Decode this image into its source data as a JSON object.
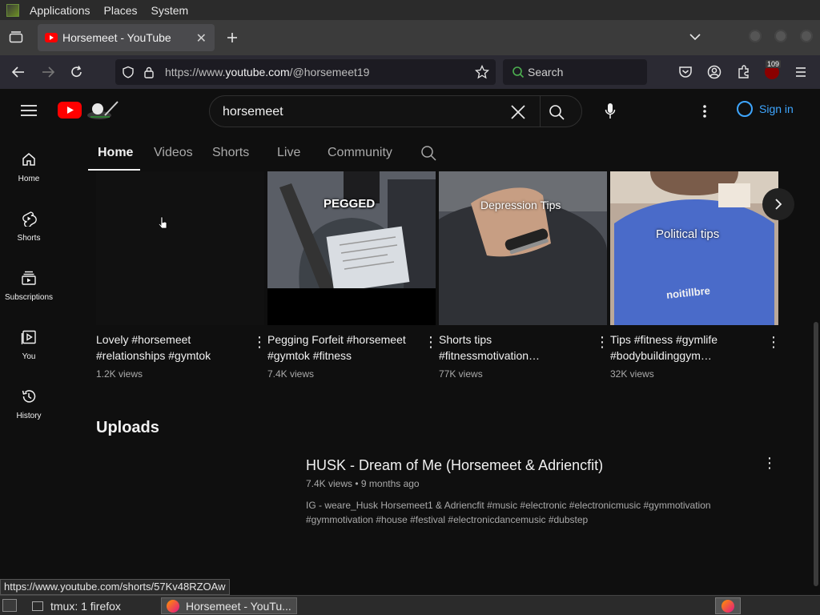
{
  "system_bar": {
    "menus": [
      "Applications",
      "Places",
      "System"
    ]
  },
  "browser": {
    "tab_title": "Horsemeet - YouTube",
    "url_prefix": "https://www.",
    "url_domain": "youtube.com",
    "url_path": "/@horsemeet19",
    "search_placeholder": "Search",
    "extension_badge": "109"
  },
  "youtube": {
    "search_query": "horsemeet",
    "sign_in": "Sign in",
    "sidebar": [
      {
        "label": "Home",
        "icon": "home-icon"
      },
      {
        "label": "Shorts",
        "icon": "shorts-icon"
      },
      {
        "label": "Subscriptions",
        "icon": "subscriptions-icon"
      },
      {
        "label": "You",
        "icon": "you-icon"
      },
      {
        "label": "History",
        "icon": "history-icon"
      }
    ],
    "channel_tabs": [
      "Home",
      "Videos",
      "Shorts",
      "Live",
      "Community"
    ],
    "shorts": [
      {
        "title_line1": "Lovely #horsemeet",
        "title_line2": "#relationships #gymtok",
        "views": "1.2K views",
        "overlay": ""
      },
      {
        "title_line1": "Pegging Forfeit #horsemeet",
        "title_line2": "#gymtok #fitness",
        "views": "7.4K views",
        "overlay": "PEGGED"
      },
      {
        "title_line1": "Shorts tips",
        "title_line2": "#fitnessmotivation…",
        "views": "77K views",
        "overlay": "Depression Tips"
      },
      {
        "title_line1": "Tips #fitness #gymlife",
        "title_line2": "#bodybuildinggym…",
        "views": "32K views",
        "overlay": "Political tips"
      }
    ],
    "shirt_text": "noitillbre",
    "uploads": {
      "heading": "Uploads",
      "video_title": "HUSK - Dream of Me (Horsemeet & Adriencfit)",
      "video_meta": "7.4K views • 9 months ago",
      "desc_line1": "IG - weare_Husk Horsemeet1 & Adriencfit #music #electronic #electronicmusic #gymmotivation",
      "desc_line2": "#gymmotivation #house #festival #electronicdancemusic #dubstep"
    }
  },
  "status_url": "https://www.youtube.com/shorts/57Kv48RZOAw",
  "taskbar": {
    "item1": "tmux: 1 firefox",
    "item2": "Horsemeet - YouTu..."
  }
}
